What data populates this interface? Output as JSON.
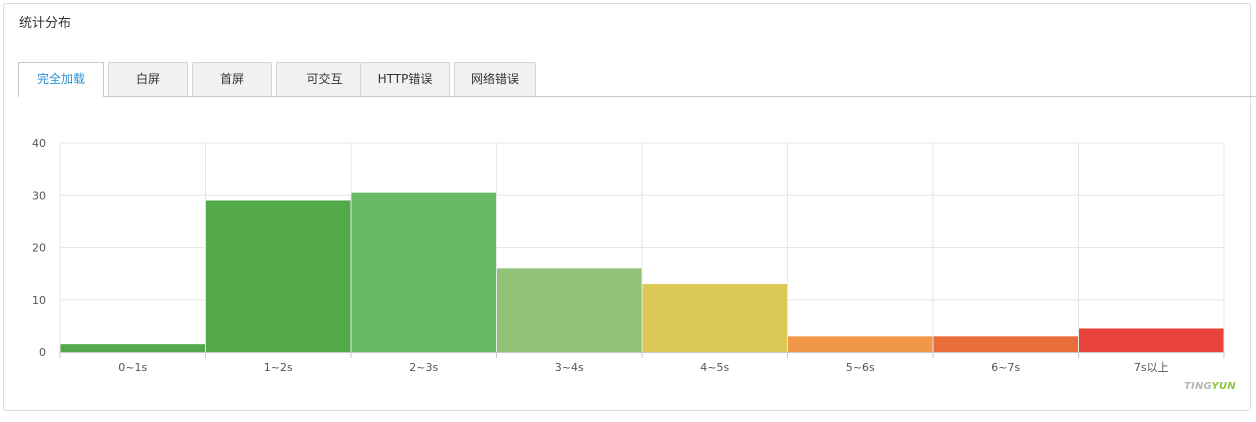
{
  "panel": {
    "title": "统计分布"
  },
  "tabs": [
    {
      "label": "完全加载",
      "active": true
    },
    {
      "label": "白屏",
      "active": false
    },
    {
      "label": "首屏",
      "active": false
    },
    {
      "label": "可交互",
      "active": false
    },
    {
      "label": "HTTP错误",
      "active": false
    },
    {
      "label": "网络错误",
      "active": false
    }
  ],
  "brand": {
    "part1": "TING",
    "part2": "YUN"
  },
  "chart_data": {
    "type": "bar",
    "categories": [
      "0~1s",
      "1~2s",
      "2~3s",
      "3~4s",
      "4~5s",
      "5~6s",
      "6~7s",
      "7s以上"
    ],
    "values": [
      1.5,
      29,
      30.5,
      16,
      13,
      3,
      3,
      4.5
    ],
    "colors": [
      "#53a94a",
      "#53a94a",
      "#69b964",
      "#8fc276",
      "#dcc955",
      "#f0974a",
      "#e96c3b",
      "#e8433b"
    ],
    "yticks": [
      0,
      10,
      20,
      30,
      40
    ],
    "ylim": [
      0,
      40
    ],
    "title": "",
    "xlabel": "",
    "ylabel": "",
    "grid": true
  }
}
